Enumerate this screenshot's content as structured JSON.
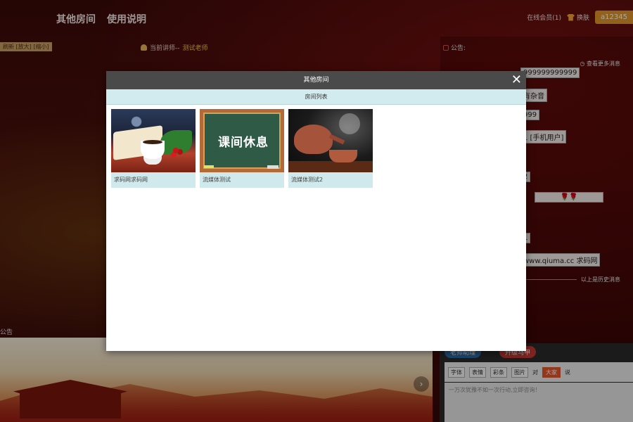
{
  "topnav": {
    "other_rooms": "其他房间",
    "instructions": "使用说明"
  },
  "top_right": {
    "online_members": "在线会员(1)",
    "skin": "换肤",
    "username": "a12345"
  },
  "toolbar_left": {
    "refresh_label": "刷新 [放大] [缩小]"
  },
  "lecturer": {
    "label": "当前讲师--",
    "teacher": "测试老师"
  },
  "notice": {
    "title": "公告:",
    "more": "查看更多消息",
    "history": "以上是历史消息"
  },
  "chat_messages": [
    "999999999999",
    "有杂音",
    "999",
    "1 [手机用户]",
    "2",
    "🌹🌹",
    "1",
    "www.qiuma.cc 求码网"
  ],
  "bottom": {
    "notice_title": "公告",
    "tag_assistant": "老师助理",
    "tag_upgrade": "升级马甲",
    "tools": [
      "字体",
      "表情",
      "彩条",
      "图片"
    ],
    "to_label": "对",
    "to_target": "大家",
    "say_label": "说",
    "input_text": "一万次犹豫不如一次行动,立即咨询！"
  },
  "modal": {
    "title": "其他房间",
    "subtitle": "房间列表",
    "rooms": [
      {
        "name": "求码网求码网"
      },
      {
        "name": "流媒体测试",
        "image_text": "课间休息"
      },
      {
        "name": "流媒体测试2"
      }
    ]
  }
}
